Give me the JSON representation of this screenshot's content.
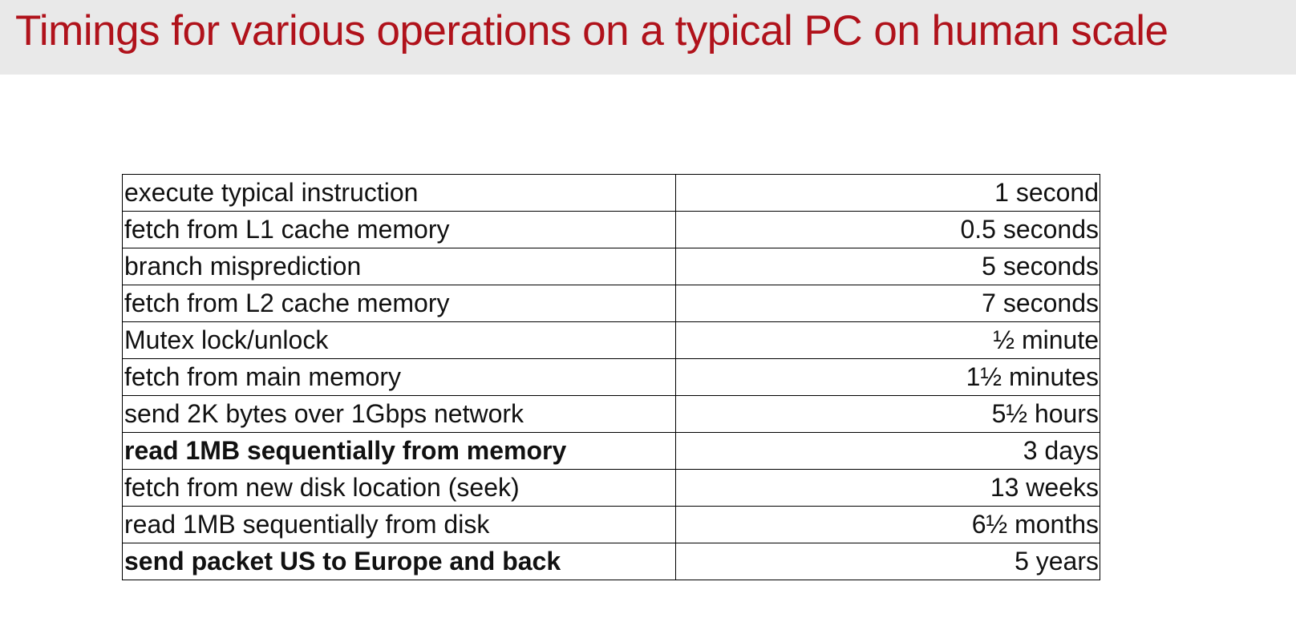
{
  "slide": {
    "title": "Timings for various operations on a typical PC on human scale"
  },
  "table": {
    "rows": [
      {
        "operation": "execute typical instruction",
        "time": "1 second",
        "bold": false
      },
      {
        "operation": "fetch from L1 cache memory",
        "time": "0.5 seconds",
        "bold": false
      },
      {
        "operation": "branch misprediction",
        "time": "5 seconds",
        "bold": false
      },
      {
        "operation": "fetch from L2 cache memory",
        "time": "7 seconds",
        "bold": false
      },
      {
        "operation": "Mutex lock/unlock",
        "time": "½ minute",
        "bold": false
      },
      {
        "operation": "fetch from main memory",
        "time": "1½ minutes",
        "bold": false
      },
      {
        "operation": "send 2K bytes over 1Gbps network",
        "time": "5½ hours",
        "bold": false
      },
      {
        "operation": "read 1MB sequentially from memory",
        "time": "3 days",
        "bold": true
      },
      {
        "operation": "fetch from new disk location (seek)",
        "time": "13 weeks",
        "bold": false
      },
      {
        "operation": "read 1MB sequentially from disk",
        "time": "6½ months",
        "bold": false
      },
      {
        "operation": "send packet US to Europe and back",
        "time": "5 years",
        "bold": true
      }
    ]
  },
  "colors": {
    "title_text": "#b0121b",
    "title_band": "#e9e9e9",
    "table_border": "#000000"
  }
}
